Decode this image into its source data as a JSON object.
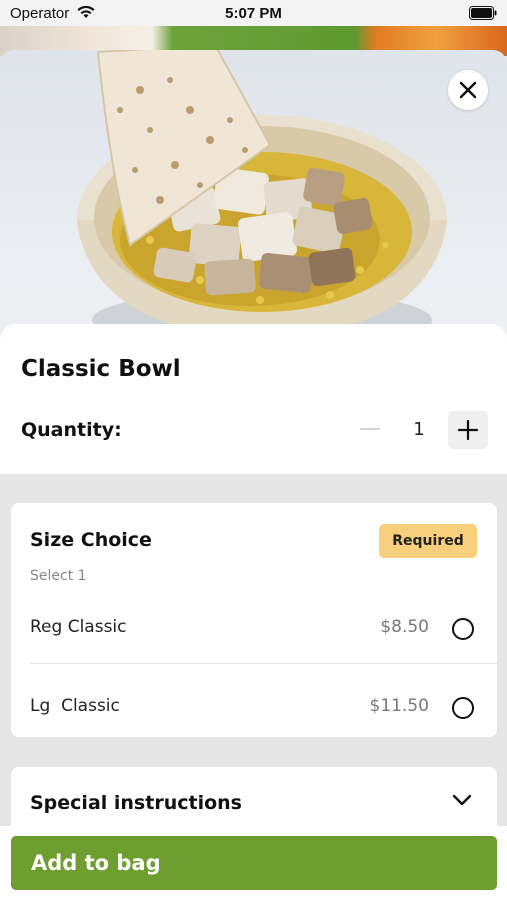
{
  "status_bar": {
    "carrier": "Operator",
    "time": "5:07 PM"
  },
  "product": {
    "image_alt": "chicken-rice-bowl",
    "title": "Classic Bowl"
  },
  "quantity": {
    "label": "Quantity:",
    "value": "1"
  },
  "size_choice": {
    "title": "Size Choice",
    "badge": "Required",
    "subtitle": "Select 1",
    "options": [
      {
        "label": "Reg Classic",
        "price": "$8.50",
        "selected": false
      },
      {
        "label": "Lg  Classic",
        "price": "$11.50",
        "selected": false
      }
    ]
  },
  "special_instructions": {
    "title": "Special instructions"
  },
  "footer": {
    "add_label": "Add to bag"
  },
  "colors": {
    "accent": "#6e9e2f",
    "badge": "#f8cf7c"
  }
}
